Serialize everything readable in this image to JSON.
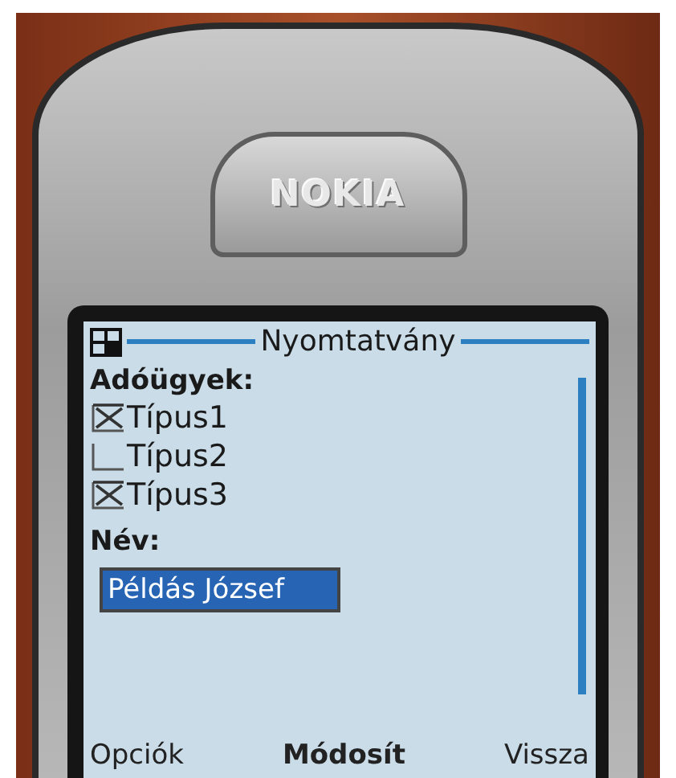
{
  "phone": {
    "logo": "NOKIA"
  },
  "screen": {
    "title": "Nyomtatvány",
    "group_label": "Adóügyek:",
    "checkboxes": [
      {
        "label": "Típus1",
        "checked": true
      },
      {
        "label": "Típus2",
        "checked": false
      },
      {
        "label": "Típus3",
        "checked": true
      }
    ],
    "name_label": "Név:",
    "name_field": {
      "value": "Példás József"
    },
    "softkeys": [
      "Opciók",
      "Módosít",
      "Vissza"
    ]
  }
}
